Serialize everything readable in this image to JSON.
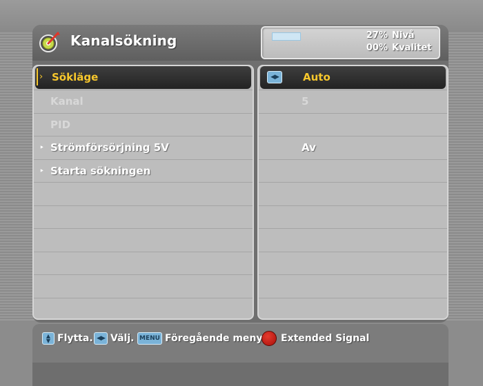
{
  "header": {
    "title": "Kanalsökning",
    "signal": {
      "level_percent": "27%",
      "level_label": "Nivå",
      "quality_percent": "00%",
      "quality_label": "Kvalitet"
    }
  },
  "menu": {
    "items": [
      {
        "label": "Sökläge",
        "value": "Auto",
        "state": "selected"
      },
      {
        "label": "Kanal",
        "value": "5",
        "state": "disabled"
      },
      {
        "label": "PID",
        "value": "",
        "state": "disabled"
      },
      {
        "label": "Strömförsörjning 5V",
        "value": "Av",
        "state": "normal"
      },
      {
        "label": "Starta sökningen",
        "value": "",
        "state": "normal"
      }
    ]
  },
  "footer": {
    "move_label": "Flytta.",
    "select_label": "Välj.",
    "menu_key": "MENU",
    "previous_menu_label": "Föregående meny",
    "extended_signal_label": "Extended Signal"
  },
  "colors": {
    "highlight": "#f7c72c",
    "selected_row": "#2a2a2a",
    "panel": "#bdbdbd",
    "key_blue": "#7ab3d8",
    "red_button": "#cc2218"
  },
  "icons": {
    "app": "satellite-dish-icon",
    "selector": "left-right-arrows-icon",
    "move": "up-down-arrows-icon",
    "red": "red-button-icon"
  }
}
